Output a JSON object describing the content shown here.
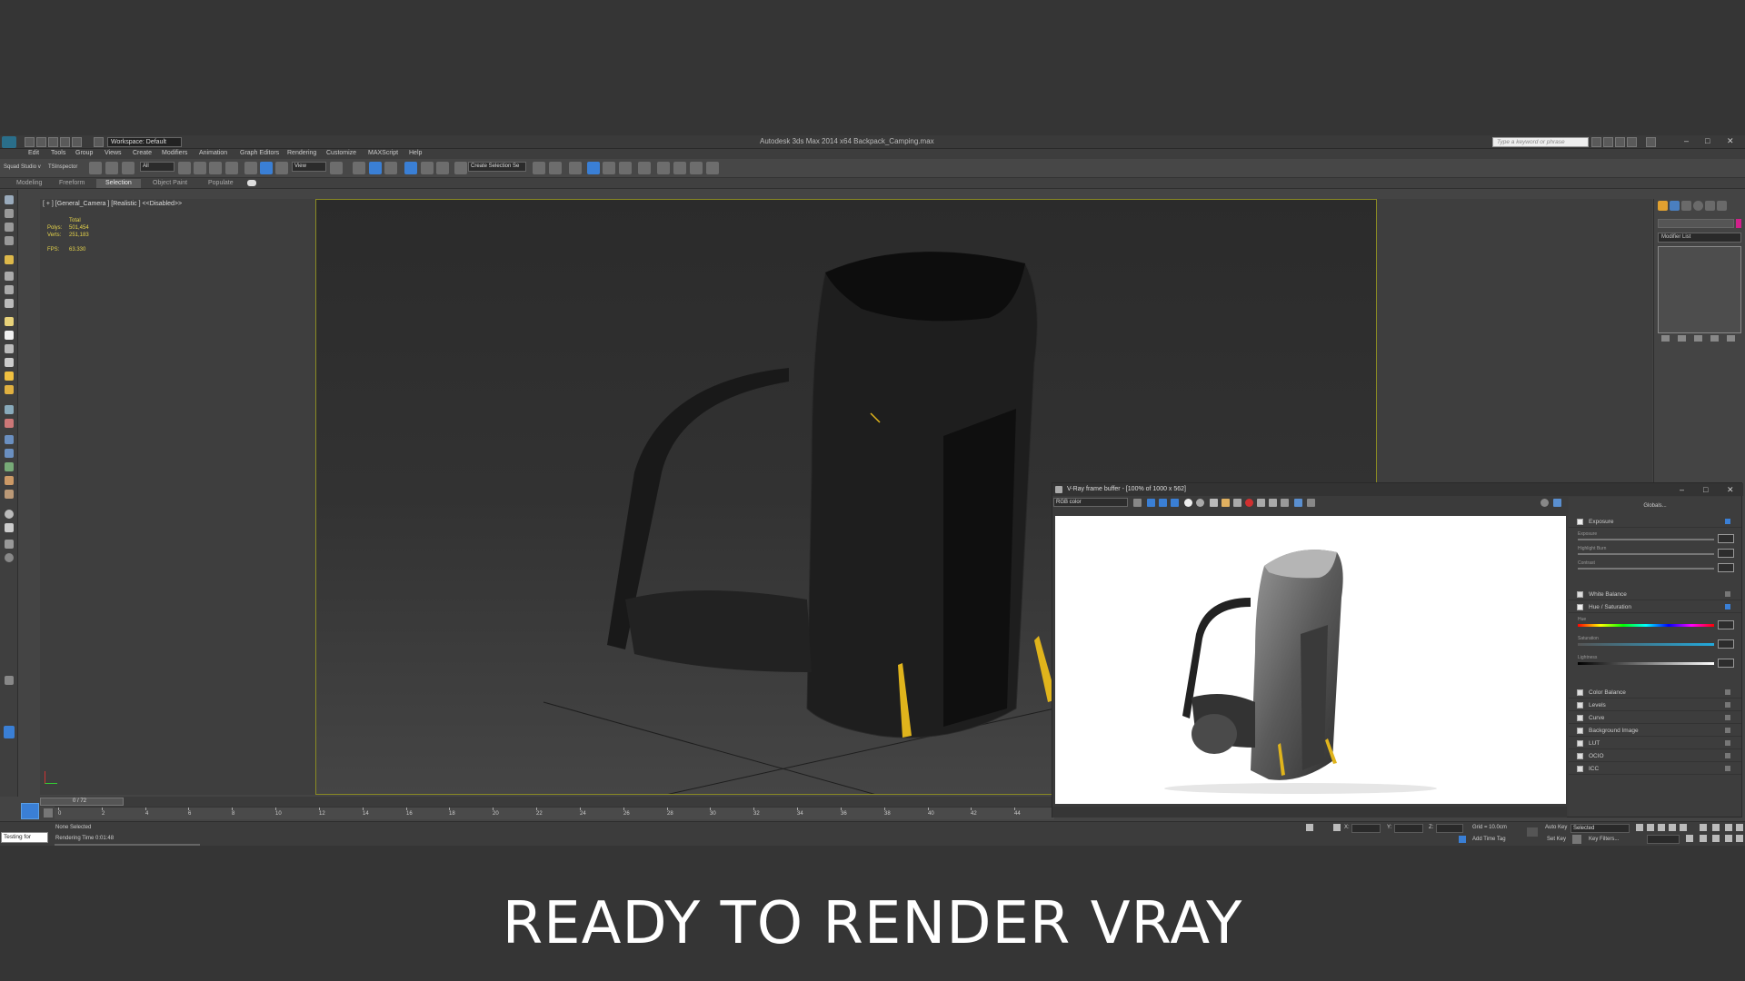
{
  "window": {
    "title": "Autodesk 3ds Max  2014 x64     Backpack_Camping.max",
    "workspace": "Workspace: Default",
    "search_placeholder": "Type a keyword or phrase"
  },
  "menu": [
    "Edit",
    "Tools",
    "Group",
    "Views",
    "Create",
    "Modifiers",
    "Animation",
    "Graph Editors",
    "Rendering",
    "Customize",
    "MAXScript",
    "Help"
  ],
  "toolbar": {
    "squad_label": "Squad Studio v",
    "inspector_label": "TSInspector",
    "filter_value": "All",
    "coord_value": "View",
    "selection_set": "Create Selection Se"
  },
  "ribbon_tabs": [
    "Modeling",
    "Freeform",
    "Selection",
    "Object Paint",
    "Populate"
  ],
  "ribbon_active": "Selection",
  "viewport": {
    "label": "[ + ] [General_Camera ] [Realistic ]  <<Disabled>>",
    "stats_header": "Total",
    "polys_label": "Polys:",
    "polys_value": "501,454",
    "verts_label": "Verts:",
    "verts_value": "251,183",
    "fps_label": "FPS:",
    "fps_value": "63.330"
  },
  "command_panel": {
    "modifier_list": "Modifier List"
  },
  "timeline": {
    "frame_counter": "0 / 72",
    "ticks": [
      "0",
      "2",
      "4",
      "6",
      "8",
      "10",
      "12",
      "14",
      "16",
      "18",
      "20",
      "22",
      "24",
      "26",
      "28",
      "30",
      "32",
      "34",
      "36",
      "38",
      "40",
      "42",
      "44"
    ]
  },
  "status": {
    "maxscript": "Testing for",
    "selection": "None Selected",
    "render_time": "Rendering Time  0:01:48",
    "x_label": "X:",
    "y_label": "Y:",
    "z_label": "Z:",
    "grid": "Grid = 10.0cm",
    "add_time_tag": "Add Time Tag",
    "auto_key": "Auto Key",
    "selected_dd": "Selected",
    "set_key": "Set Key",
    "key_filters": "Key Filters..."
  },
  "vfb": {
    "title": "V-Ray frame buffer - [100% of 1000 x 562]",
    "channel": "RGB color",
    "globals": "Globals...",
    "rows": [
      {
        "label": "Exposure",
        "checked": true
      },
      {
        "label": "White Balance",
        "checked": false
      },
      {
        "label": "Hue / Saturation",
        "checked": true
      },
      {
        "label": "Color Balance",
        "checked": false
      },
      {
        "label": "Levels",
        "checked": false
      },
      {
        "label": "Curve",
        "checked": false
      },
      {
        "label": "Background Image",
        "checked": false
      },
      {
        "label": "LUT",
        "checked": false
      },
      {
        "label": "OCIO",
        "checked": false
      },
      {
        "label": "ICC",
        "checked": false
      }
    ],
    "exposure_sliders": [
      "Exposure",
      "Highlight Burn",
      "Contrast"
    ],
    "hue_sliders": [
      "Hue",
      "Saturation",
      "Lightness"
    ]
  },
  "caption": "READY TO RENDER VRAY",
  "colors": {
    "accent_blue": "#3a7fd5",
    "viewport_frame": "#8a8a23",
    "strap_yellow": "#e0b41c"
  }
}
